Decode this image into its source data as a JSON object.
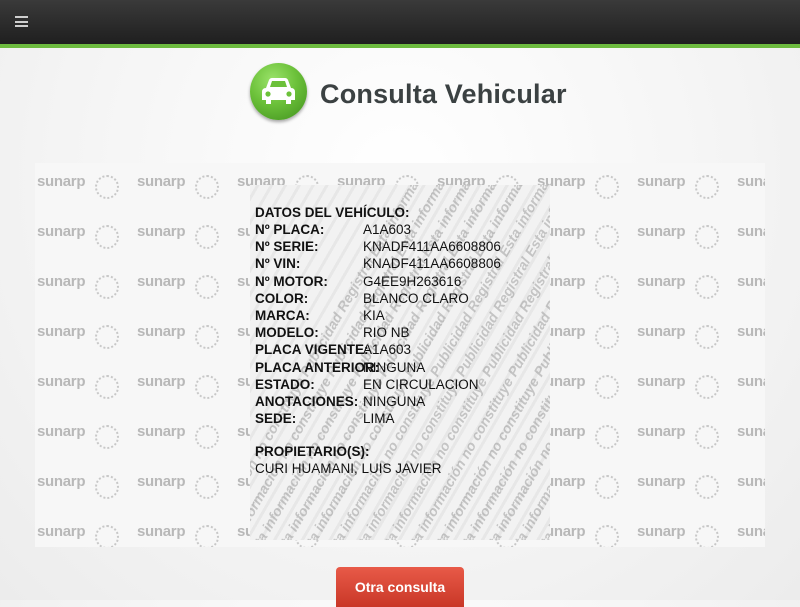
{
  "header": {
    "menu_icon": "hamburger-icon",
    "accent_color": "#6dbb3f"
  },
  "brand": {
    "title": "Consulta Vehicular",
    "icon": "car-icon"
  },
  "watermark": {
    "logo_text": "sunarp",
    "line_text": "Esta información no constituye Publicidad Registral Esta información no constituye Publicidad Registral"
  },
  "vehicle": {
    "section_title": "DATOS DEL VEHÍCULO:",
    "fields": [
      {
        "label": "Nº PLACA:",
        "value": "A1A603"
      },
      {
        "label": "Nº SERIE:",
        "value": "KNADF411AA6608806"
      },
      {
        "label": "Nº VIN:",
        "value": "KNADF411AA6608806"
      },
      {
        "label": "Nº MOTOR:",
        "value": "G4EE9H263616"
      },
      {
        "label": "COLOR:",
        "value": "BLANCO CLARO"
      },
      {
        "label": "MARCA:",
        "value": "KIA"
      },
      {
        "label": "MODELO:",
        "value": "RIO NB"
      },
      {
        "label": "PLACA VIGENTE:",
        "value": "A1A603"
      },
      {
        "label": "PLACA ANTERIOR:",
        "value": "NINGUNA"
      },
      {
        "label": "ESTADO:",
        "value": "EN CIRCULACION"
      },
      {
        "label": "ANOTACIONES:",
        "value": "NINGUNA"
      },
      {
        "label": "SEDE:",
        "value": "LIMA"
      }
    ],
    "owner_label": "PROPIETARIO(S):",
    "owner_value": "CURI HUAMANI, LUIS JAVIER"
  },
  "actions": {
    "another_query_label": "Otra consulta",
    "button_color": "#d9432f"
  }
}
